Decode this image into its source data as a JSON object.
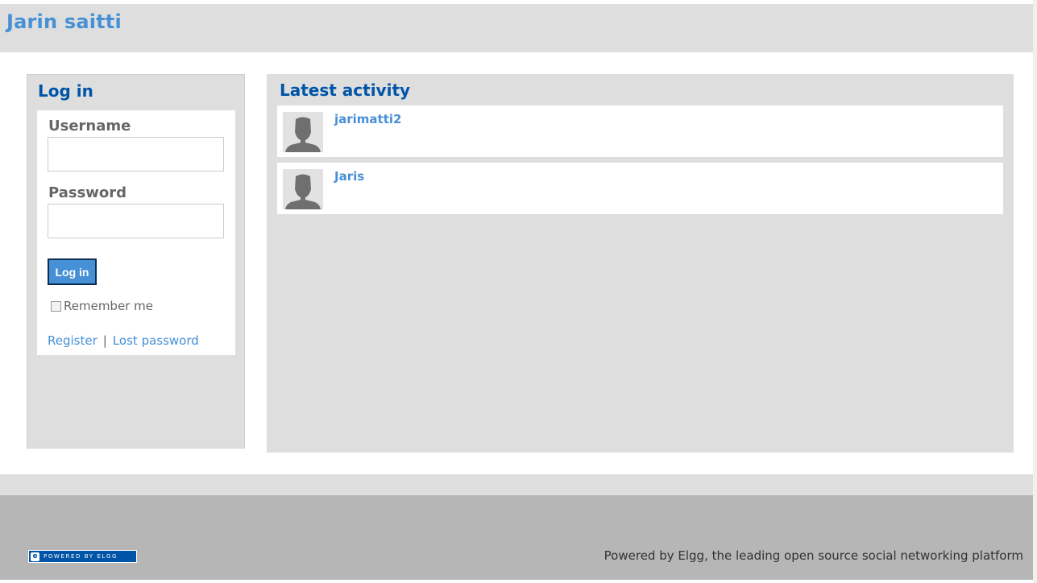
{
  "header": {
    "site_title": "Jarin saitti"
  },
  "login": {
    "heading": "Log in",
    "username_label": "Username",
    "username_value": "",
    "password_label": "Password",
    "password_value": "",
    "submit_label": "Log in",
    "remember_label": "Remember me",
    "remember_checked": false,
    "register_link": "Register",
    "separator": "|",
    "lost_password_link": "Lost password"
  },
  "activity": {
    "heading": "Latest activity",
    "items": [
      {
        "name": "jarimatti2",
        "avatar_icon": "default-user-avatar-icon"
      },
      {
        "name": "Jaris",
        "avatar_icon": "default-user-avatar-icon"
      }
    ]
  },
  "footer": {
    "badge_text": "POWERED BY ELGG",
    "powered_text": "Powered by Elgg, the leading open source social networking platform"
  },
  "colors": {
    "brand_blue": "#4690d6",
    "heading_blue": "#0054a7",
    "panel_gray": "#dedede",
    "footer_gray": "#b6b6b6"
  }
}
